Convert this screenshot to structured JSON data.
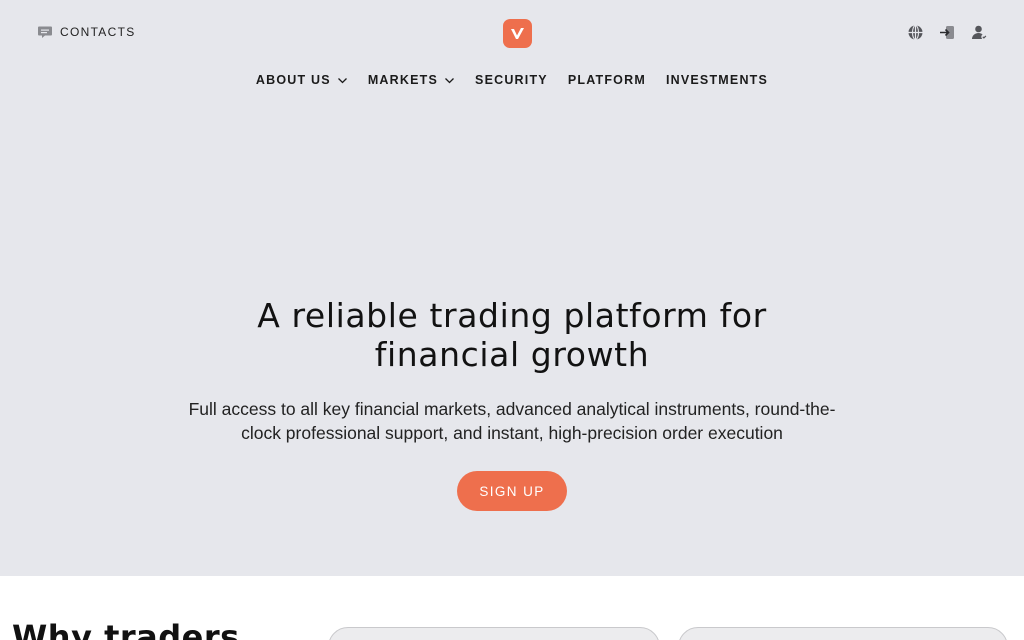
{
  "header": {
    "contacts_label": "CONTACTS",
    "contacts_icon": "chat-icon",
    "logo_icon": "brand-v-logo",
    "actions": [
      "globe-icon",
      "login-icon",
      "user-icon"
    ]
  },
  "nav": {
    "items": [
      {
        "label": "ABOUT US",
        "has_dropdown": true
      },
      {
        "label": "MARKETS",
        "has_dropdown": true
      },
      {
        "label": "SECURITY",
        "has_dropdown": false
      },
      {
        "label": "PLATFORM",
        "has_dropdown": false
      },
      {
        "label": "INVESTMENTS",
        "has_dropdown": false
      }
    ]
  },
  "hero": {
    "headline_line1": "A reliable trading platform for",
    "headline_line2": "financial growth",
    "subtitle_line1": "Full access to all key financial markets, advanced analytical instruments, round-the-",
    "subtitle_line2": "clock professional support, and instant, high-precision order execution",
    "cta_label": "SIGN UP"
  },
  "section": {
    "heading": "Why traders"
  },
  "colors": {
    "accent": "#ee6f4d",
    "hero_bg": "#e6e7ec",
    "text": "#121212"
  }
}
